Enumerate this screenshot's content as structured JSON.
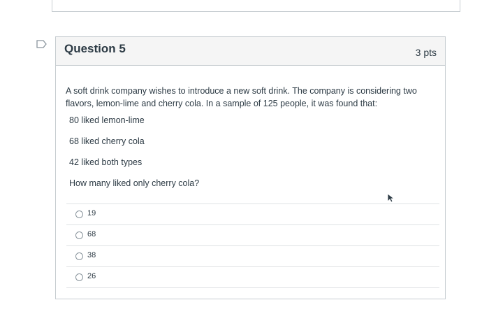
{
  "question": {
    "title": "Question 5",
    "points": "3 pts",
    "text": "A soft drink company wishes to introduce a new soft drink. The company is considering two flavors, lemon-lime and cherry cola. In a sample of 125 people, it was found that:",
    "facts": [
      "80 liked lemon-lime",
      "68 liked cherry cola",
      "42 liked both types"
    ],
    "prompt": "How many liked only cherry cola?",
    "answers": [
      "19",
      "68",
      "38",
      "26"
    ]
  },
  "icons": {
    "flag": "flag-icon",
    "radio": "radio-icon",
    "cursor": "mouse-cursor-icon"
  },
  "colors": {
    "border": "#c7cdd1",
    "header_bg": "#f5f5f5",
    "text": "#2d3b45"
  }
}
